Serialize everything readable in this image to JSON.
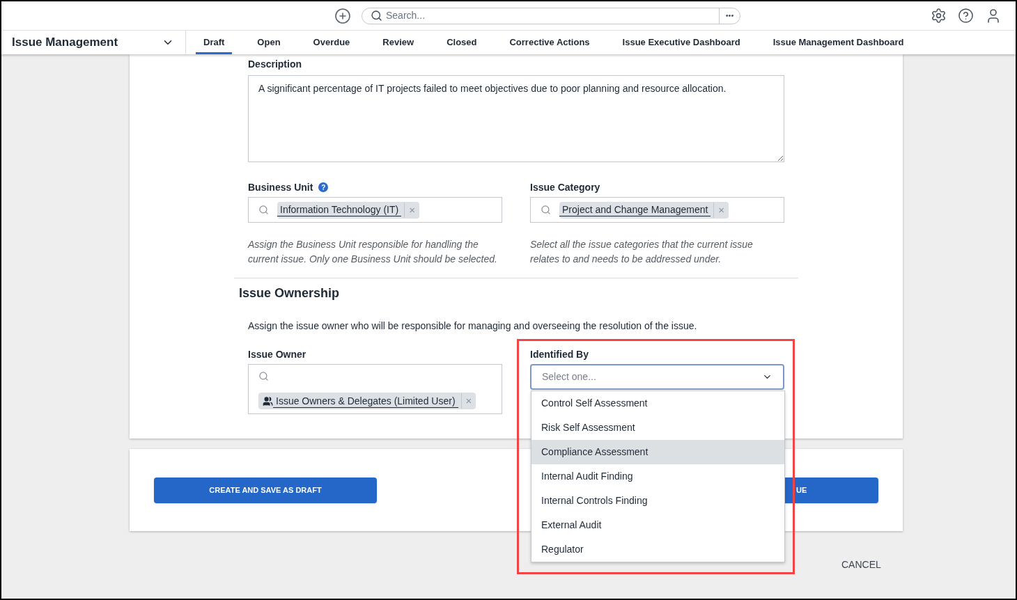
{
  "top_bar": {
    "search": {
      "placeholder": "Search..."
    },
    "more": "•••"
  },
  "module": {
    "title": "Issue Management"
  },
  "tabs": [
    {
      "label": "Draft",
      "selected": true
    },
    {
      "label": "Open",
      "selected": false
    },
    {
      "label": "Overdue",
      "selected": false
    },
    {
      "label": "Review",
      "selected": false
    },
    {
      "label": "Closed",
      "selected": false
    },
    {
      "label": "Corrective Actions",
      "selected": false
    },
    {
      "label": "Issue Executive Dashboard",
      "selected": false
    },
    {
      "label": "Issue Management Dashboard",
      "selected": false
    }
  ],
  "description": {
    "label": "Description",
    "value": "A significant percentage of IT projects failed to meet objectives due to poor planning and resource allocation."
  },
  "business_unit": {
    "label": "Business Unit",
    "help_icon": "?",
    "tag": "Information Technology (IT)",
    "remove": "×",
    "hint": "Assign the Business Unit responsible for handling the current issue. Only one Business Unit should be selected."
  },
  "issue_category": {
    "label": "Issue Category",
    "tag": "Project and Change Management",
    "remove": "×",
    "hint": "Select all the issue categories that the current issue relates to and needs to be addressed under."
  },
  "ownership": {
    "heading": "Issue Ownership",
    "text": "Assign the issue owner who will be responsible for managing and overseeing the resolution of the issue."
  },
  "issue_owner": {
    "label": "Issue Owner",
    "tag": "Issue Owners & Delegates (Limited User)",
    "remove": "×"
  },
  "identified_by": {
    "label": "Identified By",
    "placeholder": "Select one...",
    "expanded": true,
    "options": [
      {
        "label": "Control Self Assessment",
        "selected": false
      },
      {
        "label": "Risk Self Assessment",
        "selected": false
      },
      {
        "label": "Compliance Assessment",
        "selected": true
      },
      {
        "label": "Internal Audit Finding",
        "selected": false
      },
      {
        "label": "Internal Controls Finding",
        "selected": false
      },
      {
        "label": "External Audit",
        "selected": false
      },
      {
        "label": "Regulator",
        "selected": false
      }
    ]
  },
  "buttons": {
    "draft": "CREATE AND SAVE AS DRAFT",
    "second": "UE",
    "cancel": "CANCEL"
  }
}
